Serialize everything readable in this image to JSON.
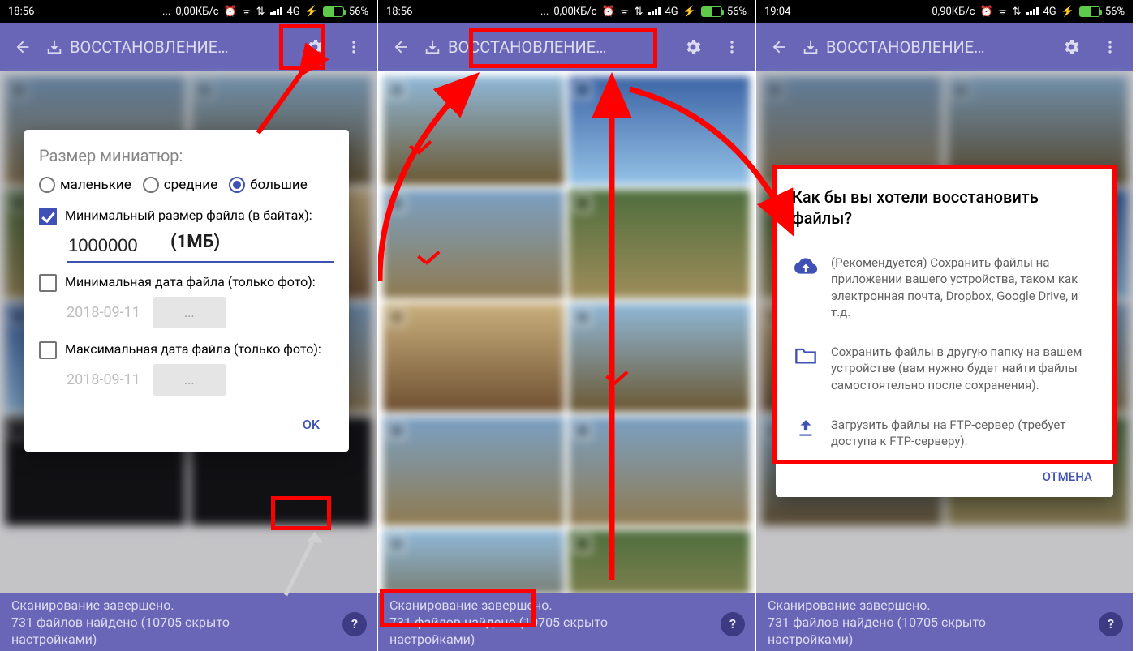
{
  "status": {
    "time_a": "18:56",
    "time_b": "18:56",
    "time_c": "19:04",
    "net_a": "0,00КБ/с",
    "net_b": "0,00КБ/с",
    "net_c": "0,90КБ/с",
    "gen": "4G",
    "batt": "56%"
  },
  "appbar": {
    "title": "ВОССТАНОВЛЕНИЕ…"
  },
  "footer": {
    "l1": "Сканирование завершено.",
    "l2a": "731 файлов найдено",
    "l2b": " (10705 скрыто ",
    "l3": "настройками",
    "l3b": ")"
  },
  "dlg1": {
    "title": "Размер миниатюр:",
    "r_small": "маленькие",
    "r_medium": "средние",
    "r_large": "большие",
    "chk_minsize": "Минимальный размер файла (в байтах):",
    "minsize_val": "1000000",
    "annot_1mb": "(1МБ)",
    "chk_mindate": "Минимальная дата файла (только фото):",
    "chk_maxdate": "Максимальная дата файла (только фото):",
    "date_val": "2018-09-11",
    "date_btn": "...",
    "ok": "OK"
  },
  "dlg3": {
    "title": "Как бы вы хотели восстановить файлы?",
    "opt1": "(Рекомендуется) Сохранить файлы на приложении вашего устройства, таком как электронная почта, Dropbox, Google Drive, и т.д.",
    "opt2": "Сохранить файлы в другую папку на вашем устройстве (вам нужно будет найти файлы самостоятельно после сохранения).",
    "opt3": "Загрузить файлы на FTP-сервер (требует доступа к FTP-серверу).",
    "cancel": "ОТМЕНА"
  }
}
